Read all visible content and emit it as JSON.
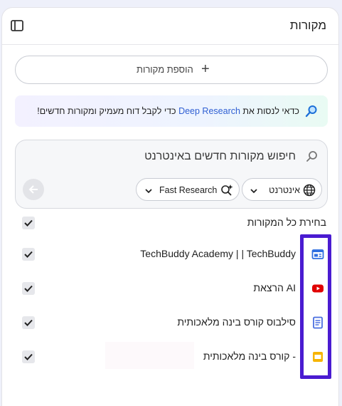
{
  "header": {
    "title": "מקורות",
    "toggle_icon": "panel-toggle-icon"
  },
  "add_source": {
    "label": "הוספת מקורות",
    "icon": "+"
  },
  "promo": {
    "prefix": "כדאי לנסות את ",
    "link": "Deep Research",
    "suffix": " כדי לקבל דוח מעמיק ומקורות חדשים!"
  },
  "search": {
    "query": "חיפוש מקורות חדשים באינטרנט",
    "chip_web": "אינטרנט",
    "chip_research": "Fast Research"
  },
  "select_all": {
    "label": "בחירת כל המקורות",
    "checked": true
  },
  "sources": [
    {
      "name": "TechBuddy Academy | | TechBuddy",
      "icon": "web-page-icon",
      "checked": true
    },
    {
      "name": "הרצאת AI",
      "icon": "youtube-icon",
      "checked": true
    },
    {
      "name": "סילבוס קורס בינה מלאכותית",
      "icon": "document-icon",
      "checked": true
    },
    {
      "name": "קורס בינה מלאכותית -",
      "icon": "slides-icon",
      "checked": true
    }
  ],
  "colors": {
    "accent": "#2f5fd3",
    "highlight": "#4a1bd1",
    "youtube": "#e00000",
    "doc": "#4a6fe0",
    "slides": "#f6b400"
  }
}
